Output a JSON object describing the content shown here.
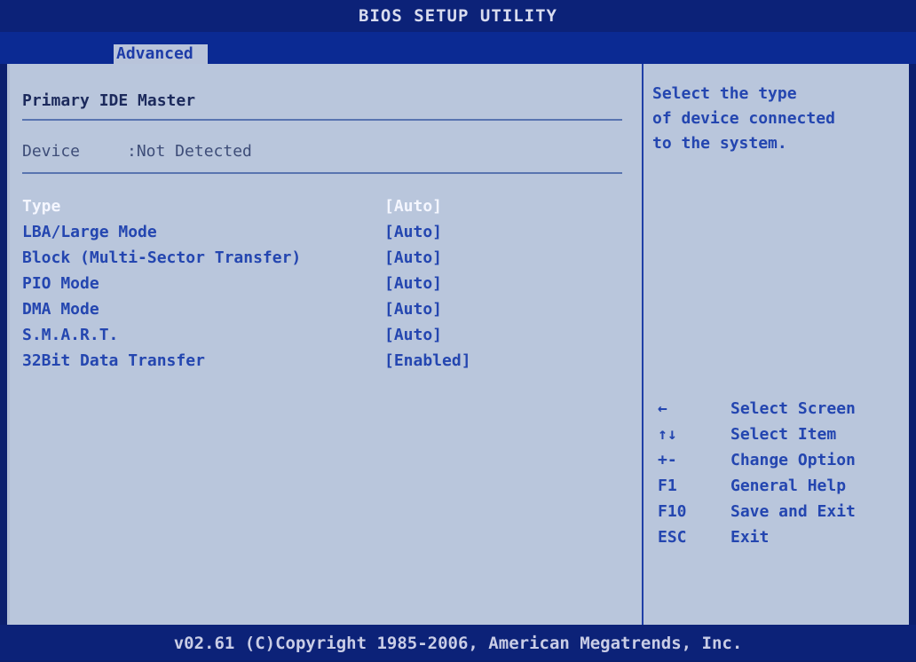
{
  "title": "BIOS SETUP UTILITY",
  "tabs": [
    {
      "label": "Advanced",
      "active": true
    }
  ],
  "page": {
    "heading": "Primary IDE Master",
    "device_label": "Device",
    "device_value": ":Not Detected"
  },
  "settings": [
    {
      "label": "Type",
      "value": "[Auto]",
      "selected": true
    },
    {
      "label": "LBA/Large Mode",
      "value": "[Auto]",
      "selected": false
    },
    {
      "label": "Block (Multi-Sector Transfer)",
      "value": "[Auto]",
      "selected": false
    },
    {
      "label": "PIO Mode",
      "value": "[Auto]",
      "selected": false
    },
    {
      "label": "DMA Mode",
      "value": "[Auto]",
      "selected": false
    },
    {
      "label": "S.M.A.R.T.",
      "value": "[Auto]",
      "selected": false
    },
    {
      "label": "32Bit Data Transfer",
      "value": "[Enabled]",
      "selected": false
    }
  ],
  "help": {
    "lines": [
      "Select the type",
      "of device connected",
      "to the system."
    ]
  },
  "keys": [
    {
      "key": "←",
      "desc": "Select Screen"
    },
    {
      "key": "↑↓",
      "desc": "Select Item"
    },
    {
      "key": "+-",
      "desc": "Change Option"
    },
    {
      "key": "F1",
      "desc": "General Help"
    },
    {
      "key": "F10",
      "desc": "Save and Exit"
    },
    {
      "key": "ESC",
      "desc": "Exit"
    }
  ],
  "footer": "v02.61 (C)Copyright 1985-2006, American Megatrends, Inc.",
  "colors": {
    "title_bg": "#0c2278",
    "panel_bg": "#b9c6dc",
    "item_text": "#2446b0",
    "selected_text": "#f4f6ff"
  }
}
